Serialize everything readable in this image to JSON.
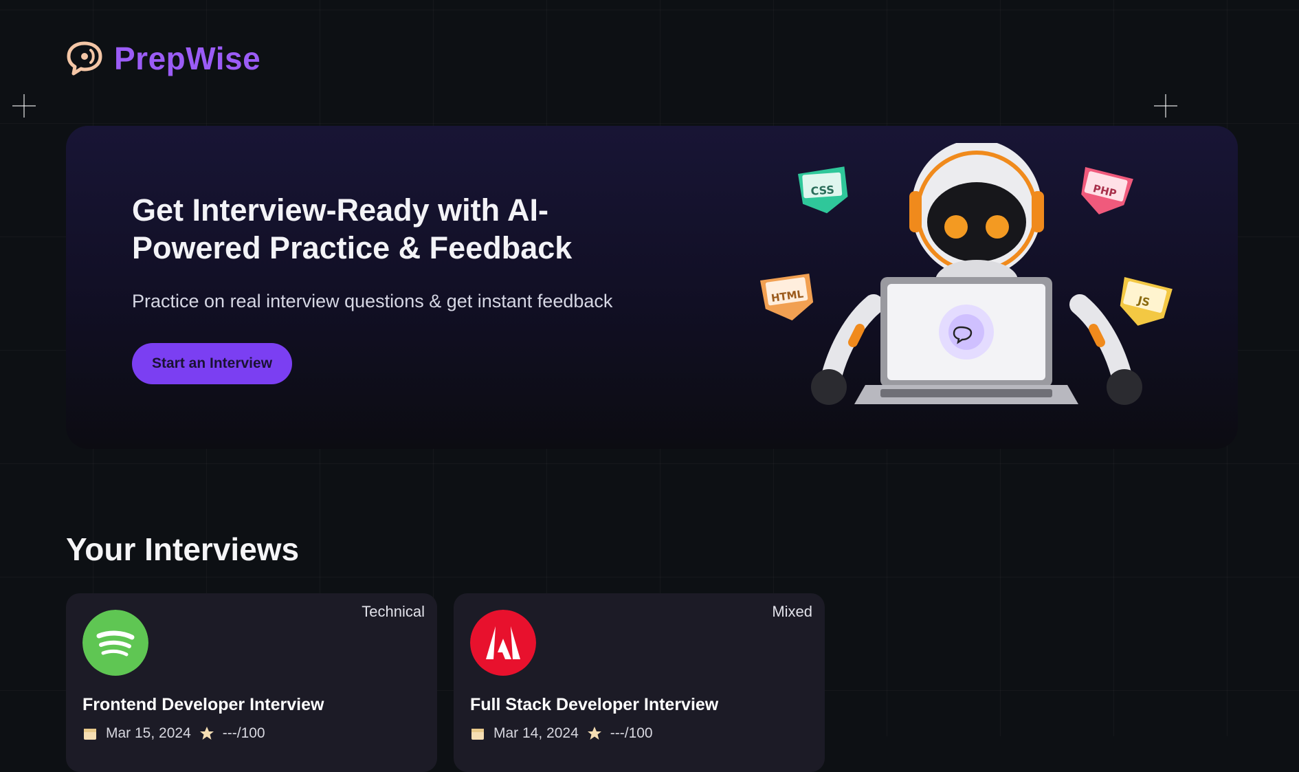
{
  "brand": {
    "name": "PrepWise",
    "accent": "#9b5cf6",
    "logo_icon": "chat-bubble-icon"
  },
  "hero": {
    "title": "Get Interview-Ready with AI-Powered Practice & Feedback",
    "subtitle": "Practice on real interview questions & get instant feedback",
    "cta_label": "Start an Interview",
    "cta_color": "#7b3ff2",
    "illustration": "robot-with-laptop-and-code-badges",
    "badges": [
      "CSS",
      "PHP",
      "HTML",
      "JS"
    ]
  },
  "interviews": {
    "heading": "Your Interviews",
    "cards": [
      {
        "type": "Technical",
        "company_icon": "spotify-logo-icon",
        "title": "Frontend Developer Interview",
        "date": "Mar 15, 2024",
        "score": "---/100"
      },
      {
        "type": "Mixed",
        "company_icon": "adobe-logo-icon",
        "title": "Full Stack Developer Interview",
        "date": "Mar 14, 2024",
        "score": "---/100"
      }
    ]
  }
}
